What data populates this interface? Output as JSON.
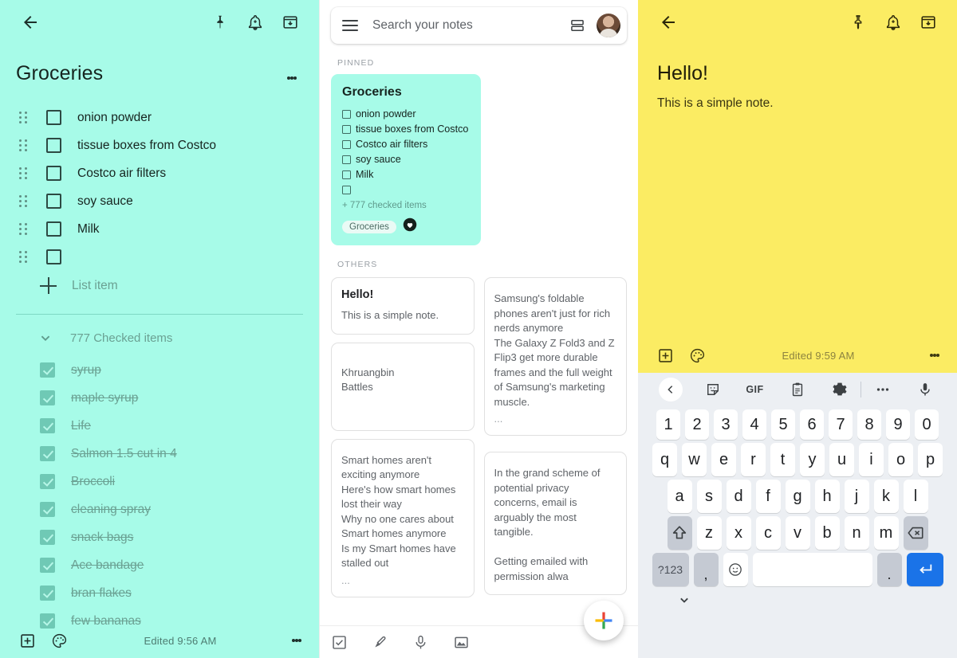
{
  "colors": {
    "mint": "#a7fbe8",
    "yellow": "#fbec63",
    "enter_blue": "#1a73e8"
  },
  "note_editor": {
    "title": "Groceries",
    "items": [
      {
        "text": "onion powder",
        "checked": false
      },
      {
        "text": "tissue boxes from Costco",
        "checked": false
      },
      {
        "text": "Costco air filters",
        "checked": false
      },
      {
        "text": "soy sauce",
        "checked": false
      },
      {
        "text": "Milk",
        "checked": false
      },
      {
        "text": "",
        "checked": false
      }
    ],
    "add_item_placeholder": "List item",
    "checked_header": "777 Checked items",
    "checked_items": [
      "syrup",
      "maple syrup",
      "Life",
      "Salmon 1.5 cut in 4",
      "Broccoli",
      "cleaning spray",
      "snack bags",
      "Ace bandage",
      "bran flakes",
      "few bananas"
    ],
    "edited": "Edited 9:56 AM",
    "icons": {
      "back": "back-arrow-icon",
      "pin": "pin-icon",
      "reminder": "add-reminder-bell-icon",
      "archive": "archive-icon",
      "overflow": "more-options-icon",
      "add": "add-box-icon",
      "palette": "color-palette-icon"
    }
  },
  "notes_list": {
    "search": {
      "placeholder": "Search your notes"
    },
    "sections": {
      "pinned": "PINNED",
      "others": "OTHERS"
    },
    "pinned_note": {
      "title": "Groceries",
      "items": [
        "onion powder",
        "tissue boxes from Costco",
        "Costco air filters",
        "soy sauce",
        "Milk",
        ""
      ],
      "more_checked": "+ 777 checked items",
      "label_chip": "Groceries"
    },
    "other_notes": [
      {
        "title": "Hello!",
        "body": "This is a simple note.",
        "ellipsis": ""
      },
      {
        "title": "",
        "body": "Khruangbin\nBattles",
        "ellipsis": ""
      },
      {
        "title": "",
        "body": "Smart homes aren't exciting anymore\nHere's how smart homes lost their way\nWhy no one cares about Smart homes anymore\nIs my Smart homes have stalled out",
        "ellipsis": "..."
      },
      {
        "title": "",
        "body": "Samsung's foldable phones aren't just for rich nerds anymore\nThe Galaxy Z Fold3 and Z Flip3 get more durable frames and the full weight of Samsung's marketing muscle.",
        "ellipsis": "..."
      },
      {
        "title": "",
        "body": "In the grand scheme of potential privacy concerns, email is arguably the most tangible.\n\nGetting emailed with permission alwa",
        "ellipsis": ""
      }
    ],
    "bottom_tools": [
      "new-list-icon",
      "new-drawing-icon",
      "new-voice-note-icon",
      "new-image-icon"
    ],
    "fab": "create-note-fab"
  },
  "yellow_note": {
    "title": "Hello!",
    "body": "This is a simple note.",
    "edited": "Edited 9:59 AM"
  },
  "keyboard": {
    "toolbar": [
      "back-chevron-icon",
      "sticker-icon",
      "GIF",
      "clipboard-icon",
      "settings-gear-icon",
      "more-dots-icon",
      "microphone-icon"
    ],
    "gif_label": "GIF",
    "rows": {
      "numbers": [
        "1",
        "2",
        "3",
        "4",
        "5",
        "6",
        "7",
        "8",
        "9",
        "0"
      ],
      "top": [
        "q",
        "w",
        "e",
        "r",
        "t",
        "y",
        "u",
        "i",
        "o",
        "p"
      ],
      "home": [
        "a",
        "s",
        "d",
        "f",
        "g",
        "h",
        "j",
        "k",
        "l"
      ],
      "bottom": [
        "z",
        "x",
        "c",
        "v",
        "b",
        "n",
        "m"
      ]
    },
    "shift": "shift-icon",
    "backspace": "backspace-icon",
    "symbols_label": "?123",
    "comma": ",",
    "emoji": "emoji-icon",
    "space": "",
    "period": ".",
    "enter": "enter-icon",
    "hide_keyboard": "hide-keyboard-chevron-icon"
  }
}
